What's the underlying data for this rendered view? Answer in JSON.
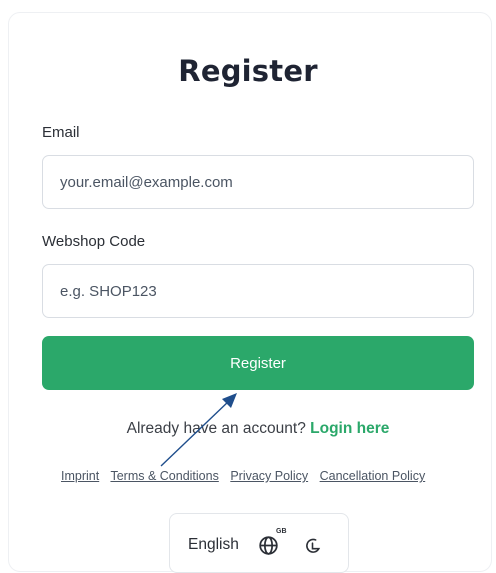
{
  "page": {
    "title": "Register"
  },
  "form": {
    "email_label": "Email",
    "email_placeholder": "your.email@example.com",
    "webshop_label": "Webshop Code",
    "webshop_placeholder": "e.g. SHOP123",
    "submit_label": "Register"
  },
  "login": {
    "prompt": "Already have an account?",
    "link_label": "Login here"
  },
  "footer": {
    "links": [
      "Imprint",
      "Terms & Conditions",
      "Privacy Policy",
      "Cancellation Policy"
    ]
  },
  "language": {
    "label": "English",
    "flag_code": "GB",
    "icons": [
      "globe-icon",
      "moon-icon"
    ]
  },
  "colors": {
    "accent": "#2ba86a",
    "annotation_arrow": "#1f4e8c"
  }
}
